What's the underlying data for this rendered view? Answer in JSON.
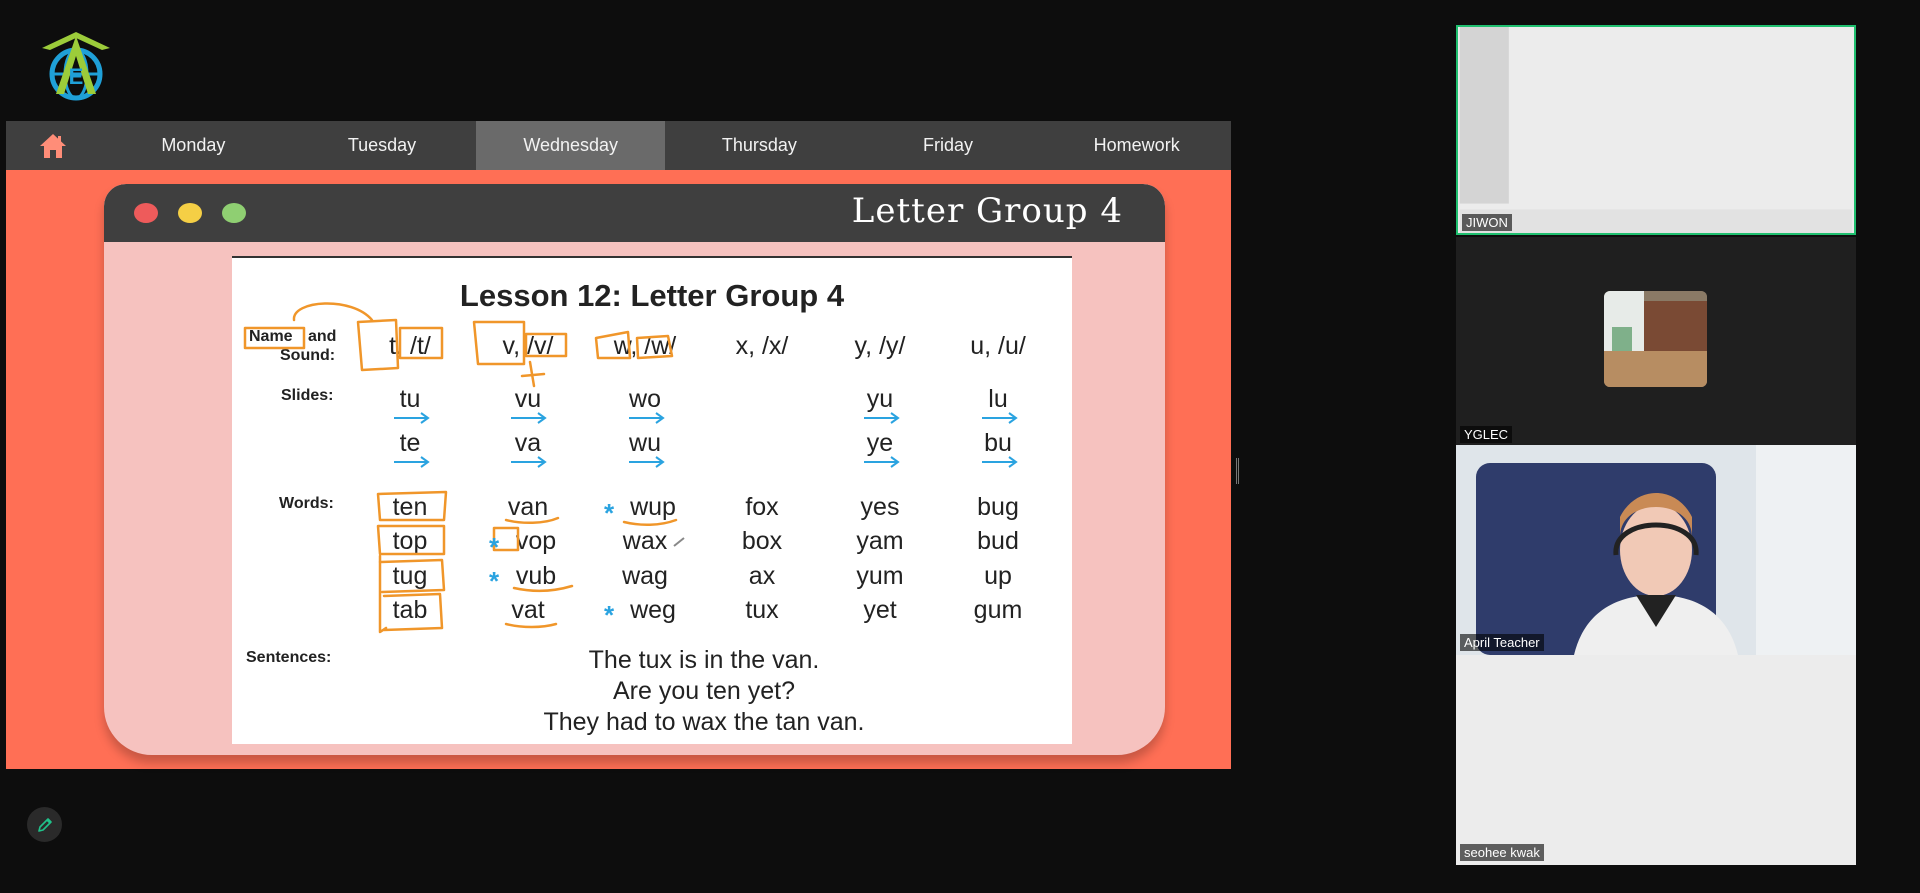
{
  "nav": {
    "home_icon": "home-icon",
    "tabs": [
      {
        "label": "Monday",
        "active": false
      },
      {
        "label": "Tuesday",
        "active": false
      },
      {
        "label": "Wednesday",
        "active": true
      },
      {
        "label": "Thursday",
        "active": false
      },
      {
        "label": "Friday",
        "active": false
      },
      {
        "label": "Homework",
        "active": false
      }
    ]
  },
  "slide": {
    "title": "Letter Group 4",
    "worksheet": {
      "title": "Lesson 12: Letter Group 4",
      "labels": {
        "name": "Name",
        "and": "and",
        "sound": "Sound:",
        "slides": "Slides:",
        "words": "Words:",
        "sentences": "Sentences:"
      },
      "sounds": [
        "t, /t/",
        "v, /v/",
        "w, /w/",
        "x, /x/",
        "y, /y/",
        "u, /u/"
      ],
      "slides_row1": [
        "tu",
        "vu",
        "wo",
        "",
        "yu",
        "lu"
      ],
      "slides_row2": [
        "te",
        "va",
        "wu",
        "",
        "ye",
        "bu"
      ],
      "words": [
        [
          "ten",
          "van",
          "wup",
          "fox",
          "yes",
          "bug"
        ],
        [
          "top",
          "vop",
          "wax",
          "box",
          "yam",
          "bud"
        ],
        [
          "tug",
          "vub",
          "wag",
          "ax",
          "yum",
          "up"
        ],
        [
          "tab",
          "vat",
          "weg",
          "tux",
          "yet",
          "gum"
        ]
      ],
      "sentences": [
        "The tux is in the van.",
        "Are you ten yet?",
        "They had to wax the tan van."
      ]
    }
  },
  "participants": [
    {
      "name": "JIWON",
      "active_speaker": true
    },
    {
      "name": "YGLEC",
      "active_speaker": false
    },
    {
      "name": "April Teacher",
      "active_speaker": false
    },
    {
      "name": "seohee kwak",
      "active_speaker": false
    }
  ],
  "colors": {
    "stage": "#ff6f55",
    "card": "#f6c2bf",
    "nav": "#3f3f3f",
    "nav_active": "#6a6a6a",
    "annotation": "#f0962a",
    "arrow": "#2aa3e0",
    "speaker_border": "#1fbf6f"
  },
  "icons": {
    "logo": "globe-logo-icon",
    "edit": "pencil-icon"
  }
}
